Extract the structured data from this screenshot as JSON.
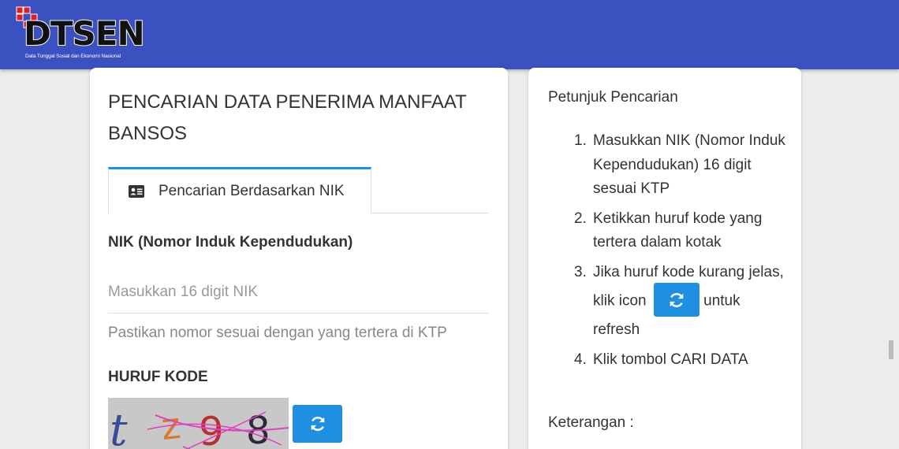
{
  "header": {
    "logo_text": "DTSEN",
    "logo_subtitle": "Data Tunggal Sosial dan Ekonomi Nasional",
    "brand_color": "#3b51c0"
  },
  "main": {
    "title": "PENCARIAN DATA PENERIMA MANFAAT BANSOS",
    "tab": {
      "label": "Pencarian Berdasarkan NIK",
      "icon": "id-card-icon"
    },
    "nik": {
      "label": "NIK (Nomor Induk Kependudukan)",
      "placeholder": "Masukkan 16 digit NIK",
      "value": "",
      "helper": "Pastikan nomor sesuai dengan yang tertera di KTP"
    },
    "kode": {
      "label": "HURUF KODE",
      "captcha_chars": "tz98",
      "refresh_icon": "refresh-icon"
    },
    "accent_color": "#1e8fe1"
  },
  "side": {
    "title": "Petunjuk Pencarian",
    "steps": [
      {
        "num": "1.",
        "text": "Masukkan NIK (Nomor Induk Kependudukan) 16 digit sesuai KTP"
      },
      {
        "num": "2.",
        "text": "Ketikkan huruf kode yang tertera dalam kotak"
      },
      {
        "num": "3.",
        "text_before": "Jika huruf kode kurang jelas, klik icon",
        "text_after": "untuk refresh"
      },
      {
        "num": "4.",
        "text": "Klik tombol CARI DATA"
      }
    ],
    "keterangan_label": "Keterangan :"
  }
}
